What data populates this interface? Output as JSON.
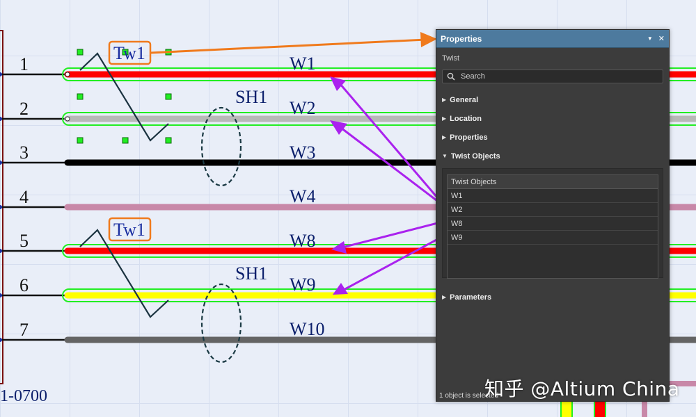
{
  "schematic": {
    "pins": [
      "1",
      "2",
      "3",
      "4",
      "5",
      "6",
      "7"
    ],
    "wires": [
      "W1",
      "W2",
      "W3",
      "W4",
      "W8",
      "W9",
      "W10"
    ],
    "twist_labels": [
      "Tw1",
      "Tw1"
    ],
    "shield_labels": [
      "SH1",
      "SH1"
    ],
    "part_number": "1-0700",
    "colors": {
      "w1": "#ff0000",
      "w2": "#b8b8b8",
      "w3": "#000000",
      "w4": "#c888a8",
      "w8": "#ff0000",
      "w9": "#ffff00",
      "w10": "#646464",
      "selection": "#22ee22",
      "arrow_orange": "#f07a1c",
      "arrow_purple": "#aa22ee"
    }
  },
  "panel": {
    "title": "Properties",
    "menu_glyph": "▼",
    "close_glyph": "✕",
    "subtitle": "Twist",
    "search_placeholder": "Search",
    "sections": {
      "general": "General",
      "location": "Location",
      "properties": "Properties",
      "twist_objects": "Twist Objects",
      "parameters": "Parameters"
    },
    "twist_table": {
      "header": "Twist Objects",
      "rows": [
        "W1",
        "W2",
        "W8",
        "W9"
      ]
    },
    "status": "1 object is selected",
    "accent": "#4d7a9e"
  },
  "watermark": "知乎 @Altium China"
}
